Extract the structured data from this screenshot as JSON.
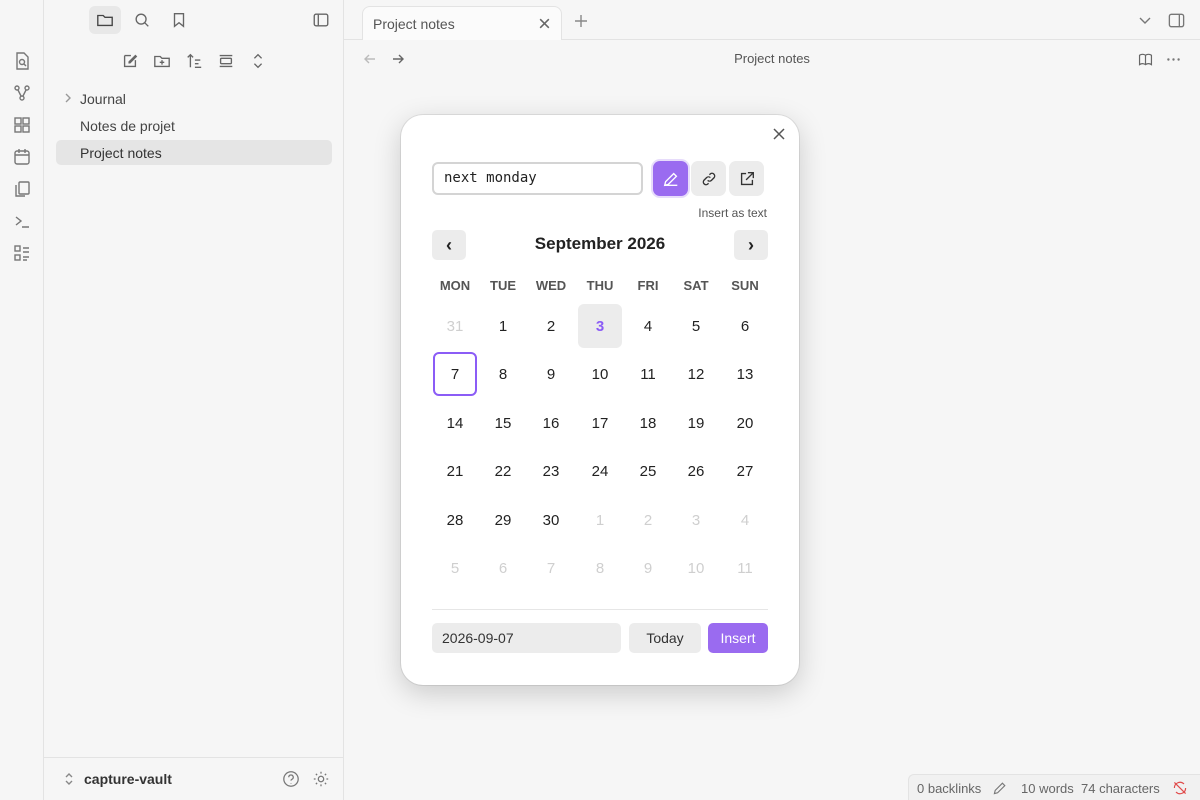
{
  "sidebar": {
    "tree": [
      {
        "label": "Journal"
      },
      {
        "label": "Notes de projet"
      },
      {
        "label": "Project notes"
      }
    ],
    "vault_name": "capture-vault"
  },
  "tabs": [
    {
      "label": "Project notes"
    }
  ],
  "view": {
    "title": "Project notes"
  },
  "status": {
    "backlinks": "0 backlinks",
    "words": "10 words",
    "characters": "74 characters"
  },
  "date_picker": {
    "query": "next monday",
    "mode_label": "Insert as text",
    "prev_label": "‹",
    "next_label": "›",
    "month_title": "September 2026",
    "weekdays": [
      "MON",
      "TUE",
      "WED",
      "THU",
      "FRI",
      "SAT",
      "SUN"
    ],
    "weeks": [
      [
        "31",
        "1",
        "2",
        "3",
        "4",
        "5",
        "6"
      ],
      [
        "7",
        "8",
        "9",
        "10",
        "11",
        "12",
        "13"
      ],
      [
        "14",
        "15",
        "16",
        "17",
        "18",
        "19",
        "20"
      ],
      [
        "21",
        "22",
        "23",
        "24",
        "25",
        "26",
        "27"
      ],
      [
        "28",
        "29",
        "30",
        "1",
        "2",
        "3",
        "4"
      ],
      [
        "5",
        "6",
        "7",
        "8",
        "9",
        "10",
        "11"
      ]
    ],
    "today_label": "3",
    "selected_label": "7",
    "date_value": "2026-09-07",
    "today_button": "Today",
    "insert_button": "Insert"
  },
  "colors": {
    "accent": "#9a6bf0",
    "today_text": "#8b5cf6"
  }
}
